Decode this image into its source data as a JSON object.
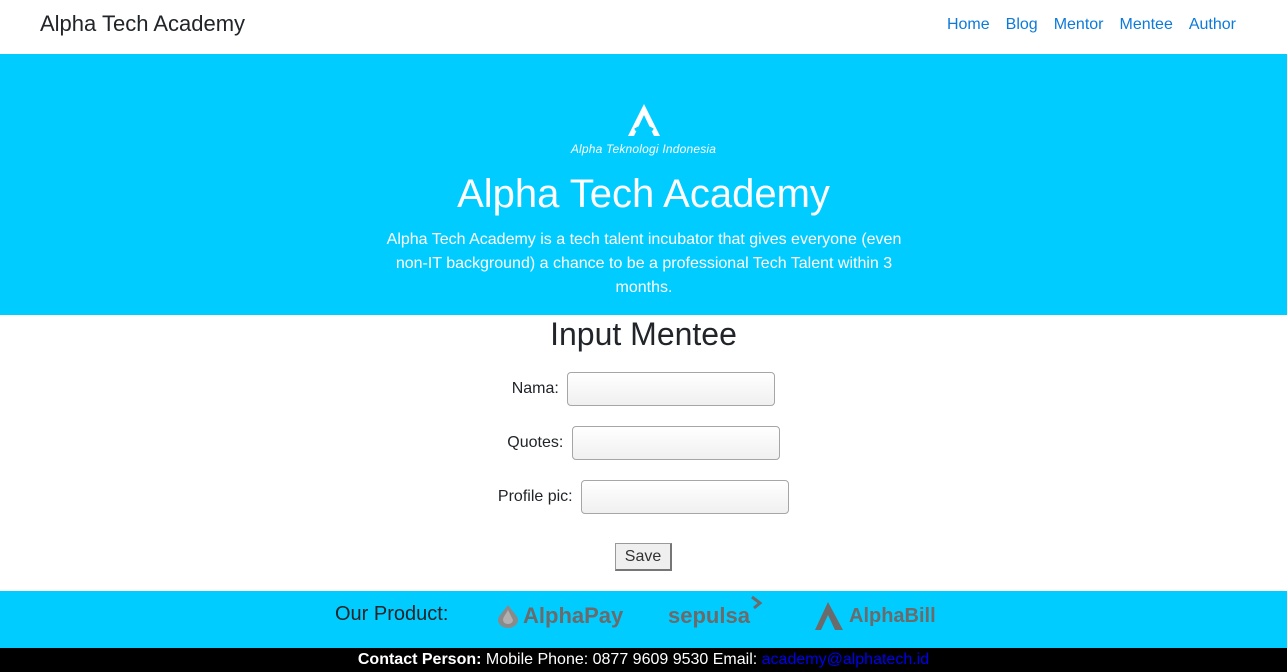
{
  "navbar": {
    "brand": "Alpha Tech Academy",
    "links": [
      "Home",
      "Blog",
      "Mentor",
      "Mentee",
      "Author"
    ]
  },
  "hero": {
    "logo_caption": "Alpha Teknologi Indonesia",
    "title": "Alpha Tech Academy",
    "description": "Alpha Tech Academy is a tech talent incubator that gives everyone (even non-IT background) a chance to be a professional Tech Talent within 3 months."
  },
  "form": {
    "title": "Input Mentee",
    "fields": [
      {
        "label": "Nama:",
        "value": ""
      },
      {
        "label": "Quotes:",
        "value": ""
      },
      {
        "label": "Profile pic:",
        "value": ""
      }
    ],
    "save_label": "Save"
  },
  "products": {
    "label": "Our Product:",
    "items": [
      "AlphaPay",
      "sepulsa",
      "AlphaBill"
    ]
  },
  "footer": {
    "contact_label": "Contact Person:",
    "phone_text": " Mobile Phone: 0877 9609 9530 Email: ",
    "email": "academy@alphatech.id"
  },
  "colors": {
    "accent": "#00ccff",
    "link": "#0d7ad9",
    "footer_bg": "#000000"
  }
}
